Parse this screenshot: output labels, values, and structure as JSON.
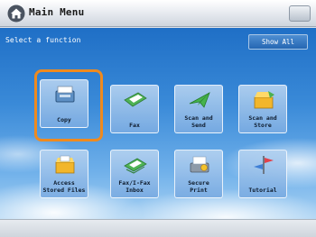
{
  "window": {
    "title": "Main Menu"
  },
  "main": {
    "prompt": "Select a function",
    "show_all_label": "Show All",
    "functions": [
      {
        "label": "Copy",
        "icon": "copy-icon",
        "selected": true
      },
      {
        "label": "Fax",
        "icon": "fax-icon"
      },
      {
        "label": "Scan and\nSend",
        "icon": "scan-send-icon"
      },
      {
        "label": "Scan and\nStore",
        "icon": "scan-store-icon"
      },
      {
        "label": "Access\nStored Files",
        "icon": "stored-files-icon"
      },
      {
        "label": "Fax/I-Fax\nInbox",
        "icon": "fax-inbox-icon"
      },
      {
        "label": "Secure\nPrint",
        "icon": "secure-print-icon"
      },
      {
        "label": "Tutorial",
        "icon": "tutorial-icon"
      }
    ]
  },
  "colors": {
    "highlight": "#ef8a1e",
    "sky_top": "#1f6fc6",
    "sky_bottom": "#a9d2f3"
  }
}
